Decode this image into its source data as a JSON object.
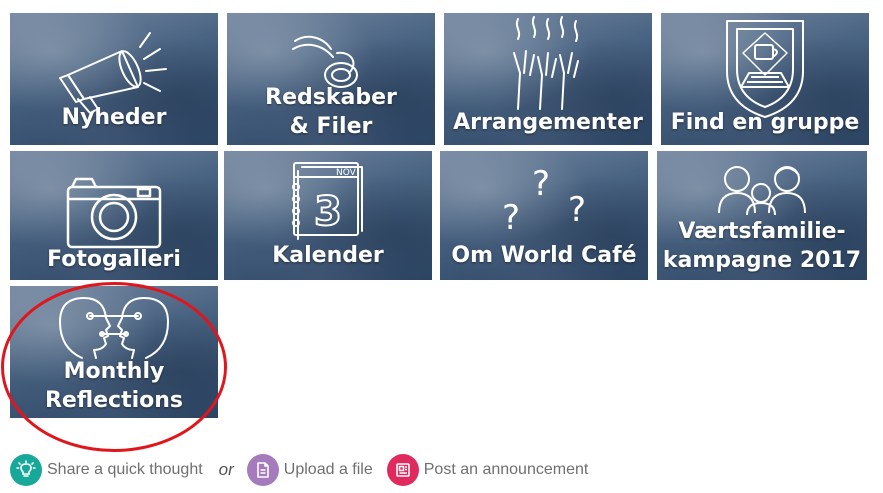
{
  "tiles": [
    {
      "id": "nyheder",
      "lines": [
        "Nyheder"
      ],
      "icon": "megaphone-icon"
    },
    {
      "id": "redskaber",
      "lines": [
        "Redskaber",
        "& Filer"
      ],
      "icon": "tools-icon"
    },
    {
      "id": "arrangementer",
      "lines": [
        "Arrangementer"
      ],
      "icon": "hands-icon"
    },
    {
      "id": "find-gruppe",
      "lines": [
        "Find en gruppe"
      ],
      "icon": "laptop-icon"
    },
    {
      "id": "fotogalleri",
      "lines": [
        "Fotogalleri"
      ],
      "icon": "camera-icon"
    },
    {
      "id": "kalender",
      "lines": [
        "Kalender"
      ],
      "icon": "calendar-icon"
    },
    {
      "id": "om-world-cafe",
      "lines": [
        "Om World Café"
      ],
      "icon": "question-marks-icon"
    },
    {
      "id": "vaertsfamilie",
      "lines": [
        "Værtsfamilie-",
        "kampagne 2017"
      ],
      "icon": "family-icon"
    },
    {
      "id": "monthly-reflections",
      "lines": [
        "Monthly",
        "Reflections"
      ],
      "icon": "faces-icon"
    }
  ],
  "calendar_icon": {
    "month": "NOV",
    "day": "3"
  },
  "question_mark": "?",
  "actions": {
    "thought": {
      "label": "Share a quick thought",
      "icon": "lightbulb-icon",
      "color": "#17a89a"
    },
    "or": "or",
    "upload": {
      "label": "Upload a file",
      "icon": "file-icon",
      "color": "#a57bbd"
    },
    "announce": {
      "label": "Post an announcement",
      "icon": "announcement-icon",
      "color": "#e02a5e"
    }
  },
  "highlight_color": "#e0161d"
}
